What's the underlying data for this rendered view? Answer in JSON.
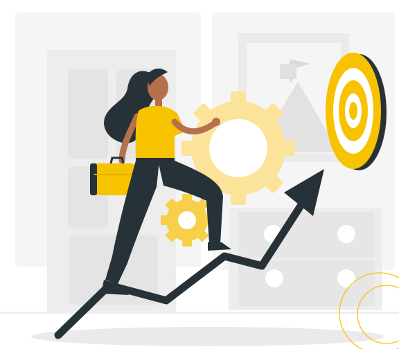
{
  "illustration": {
    "subject": "woman-climbing-growth-arrow-toward-target",
    "colors": {
      "accent": "#F7C200",
      "accent_light": "#FBE39A",
      "dark": "#263238",
      "skin": "#B5704C",
      "background_shapes": "#F3F3F3",
      "background_shapes_dark": "#EBEBEB",
      "ground_shadow": "#E6E6E6"
    },
    "icons": [
      "bullseye-target-icon",
      "growth-arrow-icon",
      "large-gear-icon",
      "small-gear-icon",
      "briefcase-icon",
      "mountain-flag-picture-icon"
    ]
  }
}
